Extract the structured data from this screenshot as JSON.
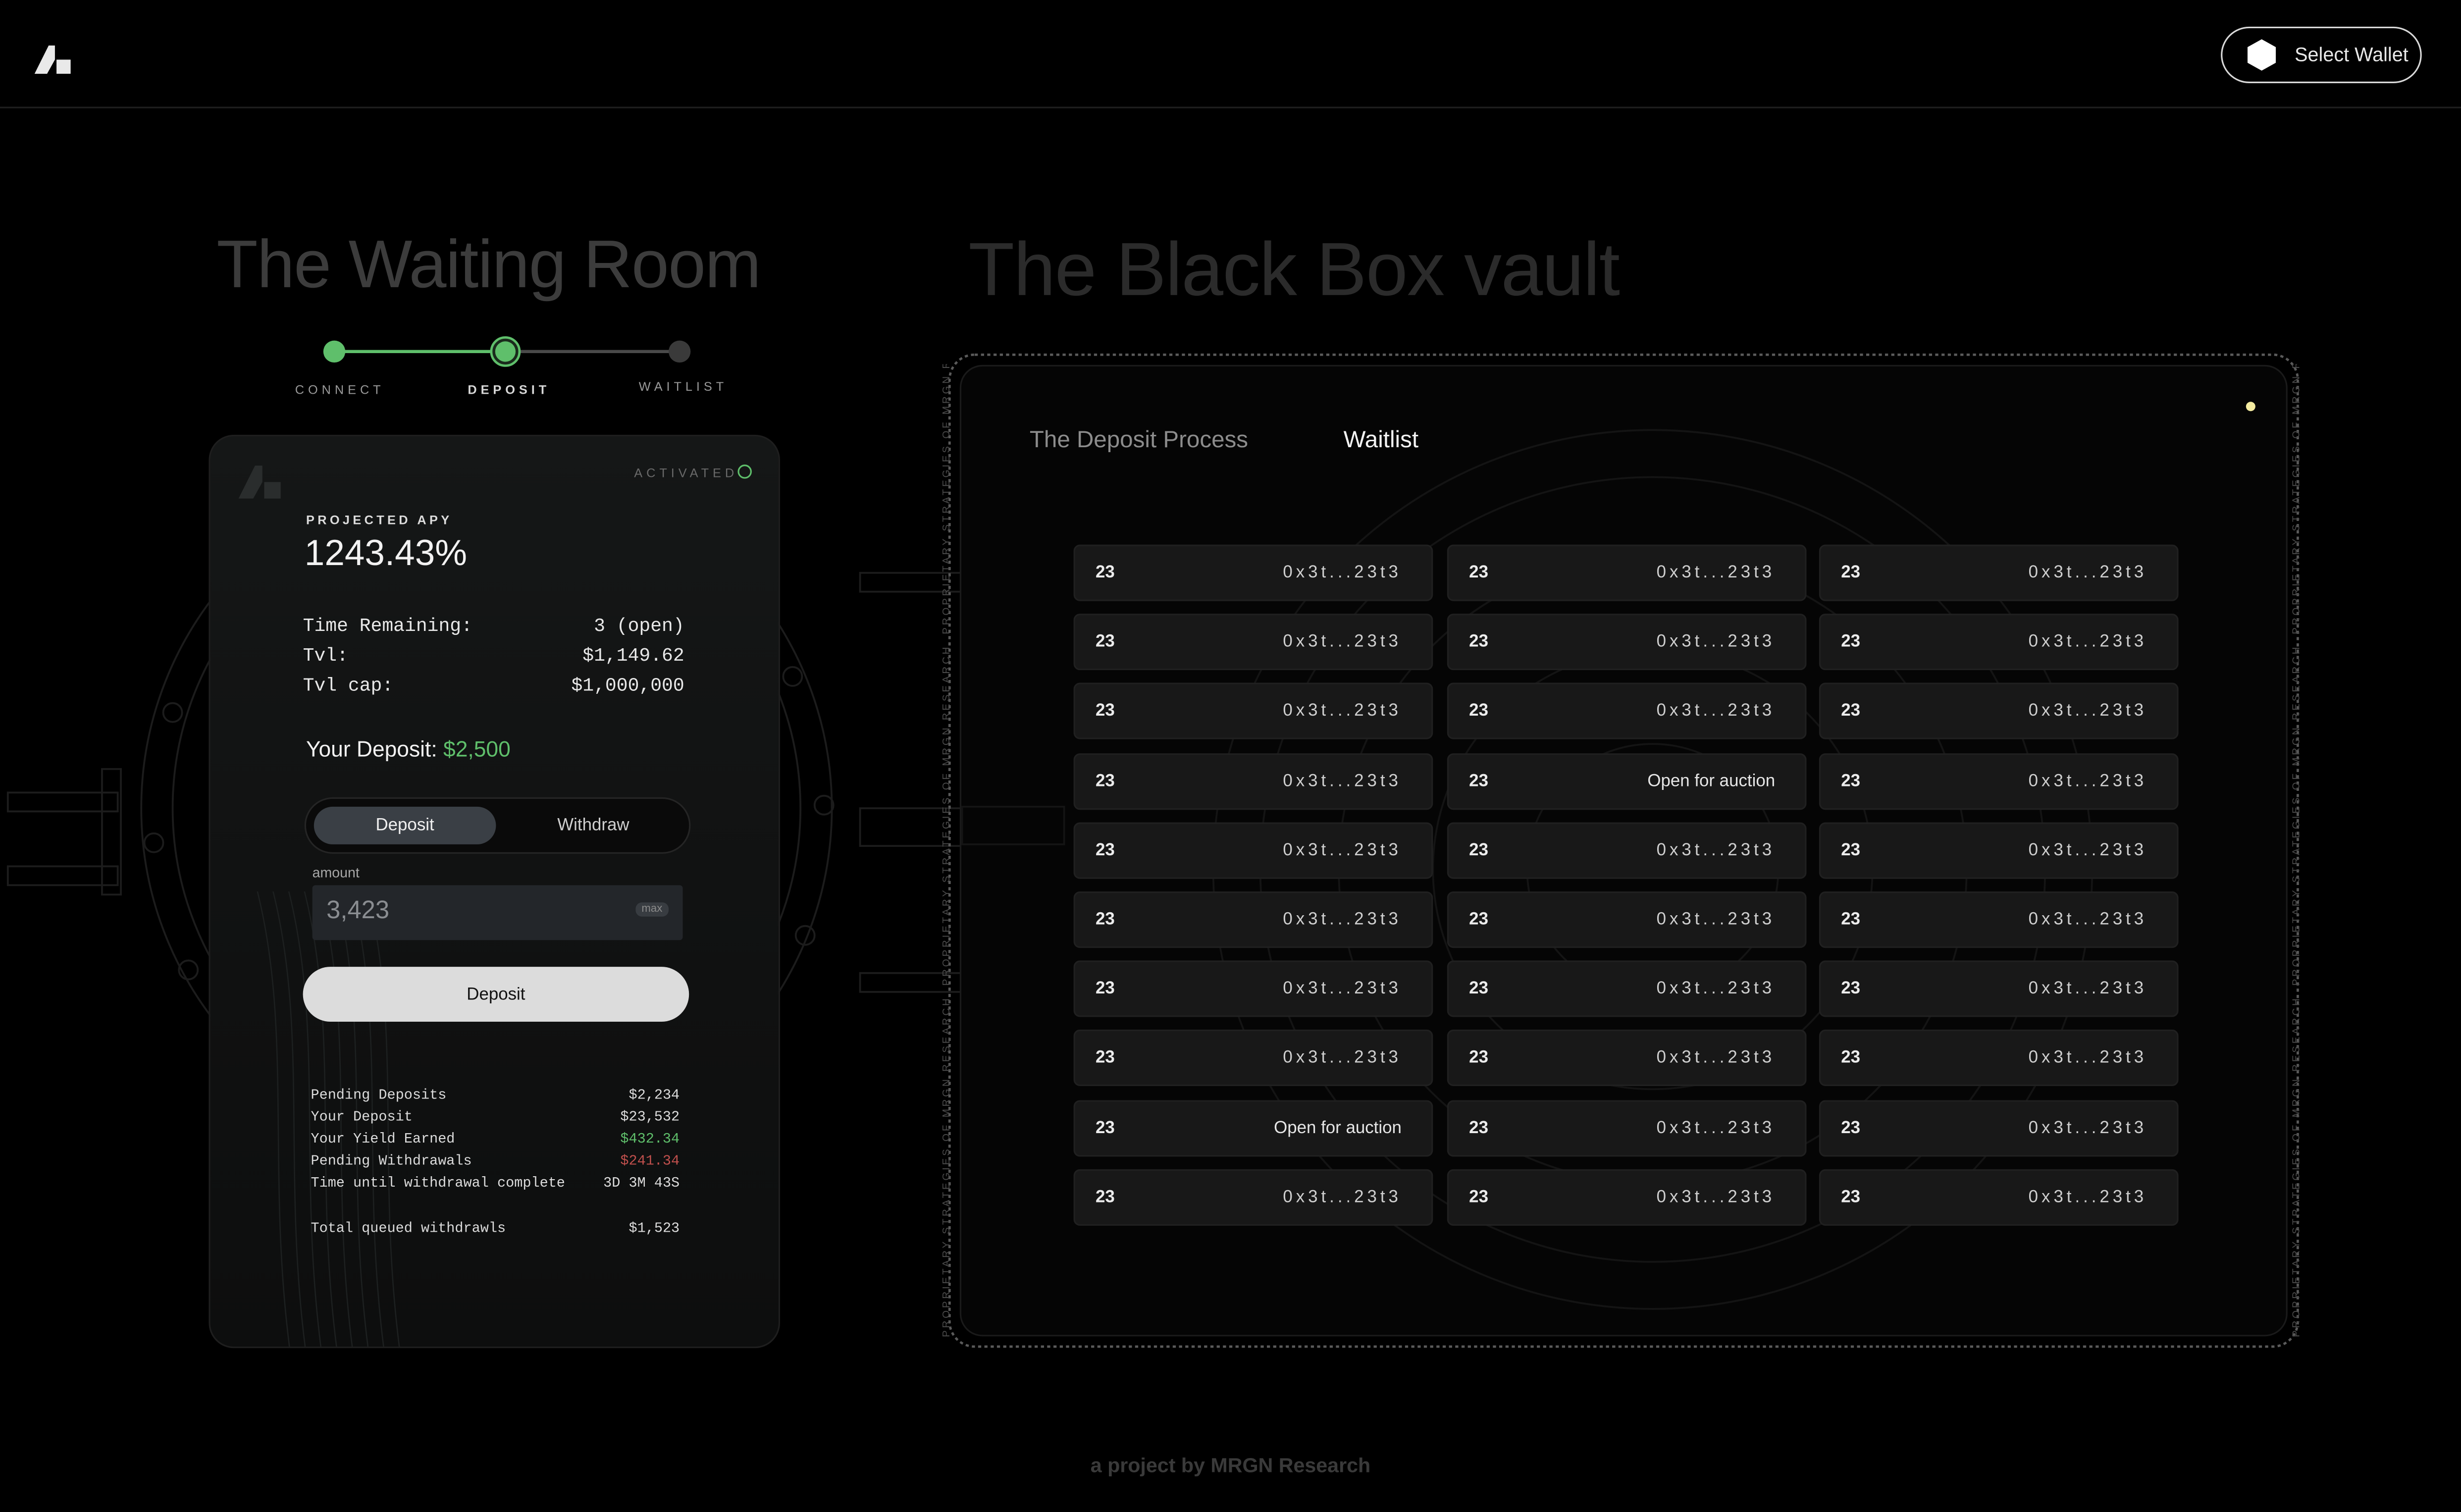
{
  "header": {
    "wallet_button": "Select Wallet"
  },
  "titles": {
    "left": "The Waiting Room",
    "right": "The Black Box vault"
  },
  "stepper": {
    "steps": [
      "CONNECT",
      "DEPOSIT",
      "WAITLIST"
    ],
    "active_index": 1
  },
  "card": {
    "status": "ACTIVATED",
    "apy_label": "PROJECTED APY",
    "apy_value": "1243.43%",
    "info": [
      {
        "label": "Time Remaining:",
        "value": "3 (open)"
      },
      {
        "label": "Tvl:",
        "value": "$1,149.62"
      },
      {
        "label": "Tvl cap:",
        "value": "$1,000,000"
      }
    ],
    "your_deposit_label": "Your Deposit:",
    "your_deposit_value": "$2,500",
    "segment": {
      "active": "Deposit",
      "inactive": "Withdraw"
    },
    "amount_label": "amount",
    "amount_value": "3,423",
    "max_label": "max",
    "deposit_button": "Deposit",
    "stats": [
      {
        "label": "Pending Deposits",
        "value": "$2,234"
      },
      {
        "label": "Your Deposit",
        "value": "$23,532"
      },
      {
        "label": "Your Yield Earned",
        "value": "$432.34"
      },
      {
        "label": "Pending Withdrawals",
        "value": "$241.34"
      },
      {
        "label": "Time until withdrawal complete",
        "value": "3D 3M 43S"
      },
      {
        "label": "Total queued withdrawls",
        "value": "$1,523"
      }
    ]
  },
  "vault": {
    "tabs": [
      "The Deposit Process",
      "Waitlist"
    ],
    "active_tab": "Waitlist",
    "border_text": "PROPRIETARY STRATEGIES OF MRGN RESEARCH",
    "waitlist": [
      [
        {
          "num": "23",
          "text": "0x3t...23t3"
        },
        {
          "num": "23",
          "text": "0x3t...23t3"
        },
        {
          "num": "23",
          "text": "0x3t...23t3"
        }
      ],
      [
        {
          "num": "23",
          "text": "0x3t...23t3"
        },
        {
          "num": "23",
          "text": "0x3t...23t3"
        },
        {
          "num": "23",
          "text": "0x3t...23t3"
        }
      ],
      [
        {
          "num": "23",
          "text": "0x3t...23t3"
        },
        {
          "num": "23",
          "text": "0x3t...23t3"
        },
        {
          "num": "23",
          "text": "0x3t...23t3"
        }
      ],
      [
        {
          "num": "23",
          "text": "0x3t...23t3"
        },
        {
          "num": "23",
          "text": "Open for auction",
          "auction": true
        },
        {
          "num": "23",
          "text": "0x3t...23t3"
        }
      ],
      [
        {
          "num": "23",
          "text": "0x3t...23t3"
        },
        {
          "num": "23",
          "text": "0x3t...23t3"
        },
        {
          "num": "23",
          "text": "0x3t...23t3"
        }
      ],
      [
        {
          "num": "23",
          "text": "0x3t...23t3"
        },
        {
          "num": "23",
          "text": "0x3t...23t3"
        },
        {
          "num": "23",
          "text": "0x3t...23t3"
        }
      ],
      [
        {
          "num": "23",
          "text": "0x3t...23t3"
        },
        {
          "num": "23",
          "text": "0x3t...23t3"
        },
        {
          "num": "23",
          "text": "0x3t...23t3"
        }
      ],
      [
        {
          "num": "23",
          "text": "0x3t...23t3"
        },
        {
          "num": "23",
          "text": "0x3t...23t3"
        },
        {
          "num": "23",
          "text": "0x3t...23t3"
        }
      ],
      [
        {
          "num": "23",
          "text": "Open for auction",
          "auction": true
        },
        {
          "num": "23",
          "text": "0x3t...23t3"
        },
        {
          "num": "23",
          "text": "0x3t...23t3"
        }
      ],
      [
        {
          "num": "23",
          "text": "0x3t...23t3"
        },
        {
          "num": "23",
          "text": "0x3t...23t3"
        },
        {
          "num": "23",
          "text": "0x3t...23t3"
        }
      ]
    ]
  },
  "footer": "a project by MRGN Research",
  "colors": {
    "accent_green": "#5fbf6b",
    "negative_red": "#c0504d",
    "dot_yellow": "#f4eba0"
  }
}
